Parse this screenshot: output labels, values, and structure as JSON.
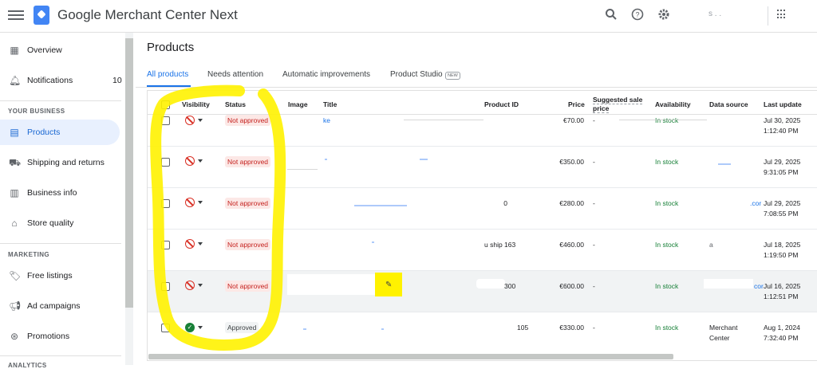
{
  "app": {
    "title": "Google Merchant Center Next",
    "account": "s . ."
  },
  "icons": {
    "search": "search-icon",
    "help": "help-icon",
    "settings": "gear-icon",
    "apps": "apps-grid-icon"
  },
  "sidebar": {
    "items": [
      {
        "label": "Overview",
        "icon": "dashboard-icon"
      },
      {
        "label": "Notifications",
        "icon": "bell-icon",
        "badge": "10"
      },
      {
        "label": "Products",
        "icon": "products-icon",
        "active": true
      },
      {
        "label": "Shipping and returns",
        "icon": "truck-icon"
      },
      {
        "label": "Business info",
        "icon": "business-icon"
      },
      {
        "label": "Store quality",
        "icon": "store-icon"
      },
      {
        "label": "Free listings",
        "icon": "tag-icon"
      },
      {
        "label": "Ad campaigns",
        "icon": "megaphone-icon"
      },
      {
        "label": "Promotions",
        "icon": "promotion-icon"
      }
    ],
    "headings": {
      "business": "YOUR BUSINESS",
      "marketing": "MARKETING",
      "analytics": "ANALYTICS"
    }
  },
  "page": {
    "title": "Products"
  },
  "tabs": [
    {
      "label": "All products",
      "active": true
    },
    {
      "label": "Needs attention"
    },
    {
      "label": "Automatic improvements"
    },
    {
      "label": "Product Studio",
      "badge": "NEW"
    }
  ],
  "table": {
    "columns": {
      "visibility": "Visibility",
      "status": "Status",
      "image": "Image",
      "title": "Title",
      "product_id": "Product ID",
      "price": "Price",
      "suggested_price": "Suggested sale price",
      "availability": "Availability",
      "data_source": "Data source",
      "last_update": "Last update"
    },
    "rows": [
      {
        "status": "Not approved",
        "title": "ke",
        "price": "€70.00",
        "suggested": "-",
        "availability": "In stock",
        "date": "Jul 30, 2025",
        "time": "1:12:40 PM"
      },
      {
        "status": "Not approved",
        "title": "",
        "price": "€350.00",
        "suggested": "-",
        "availability": "In stock",
        "date": "Jul 29, 2025",
        "time": "9:31:05 PM"
      },
      {
        "status": "Not approved",
        "product_id": "0",
        "price": "€280.00",
        "suggested": "-",
        "availability": "In stock",
        "data_source": ".cor",
        "date": "Jul 29, 2025",
        "time": "7:08:55 PM"
      },
      {
        "status": "Not approved",
        "product_id": "u ship 163",
        "price": "€460.00",
        "suggested": "-",
        "availability": "In stock",
        "data_source": "a",
        "date": "Jul 18, 2025",
        "time": "1:19:50 PM"
      },
      {
        "status": "Not approved",
        "product_id": "300",
        "price": "€600.00",
        "suggested": "-",
        "availability": "In stock",
        "data_source": "cor",
        "date": "Jul 16, 2025",
        "time": "1:12:51 PM"
      },
      {
        "status": "Approved",
        "product_id": "105",
        "price": "€330.00",
        "suggested": "-",
        "availability": "In stock",
        "data_source_line1": "Merchant",
        "data_source_line2": "Center",
        "date": "Aug 1, 2024",
        "time": "7:32:40 PM"
      }
    ]
  },
  "colors": {
    "accent": "#1a73e8",
    "active_bg": "#e8f0fe",
    "error": "#d93025",
    "success": "#188038",
    "highlight": "#fff200"
  }
}
